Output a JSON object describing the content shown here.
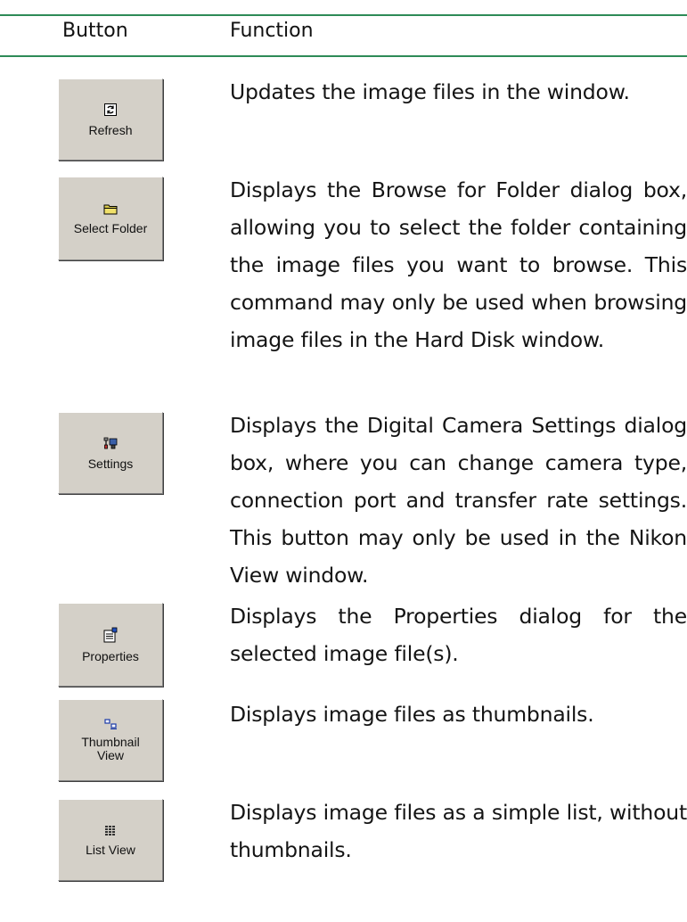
{
  "header": {
    "col_button": "Button",
    "col_function": "Function"
  },
  "rows": [
    {
      "button_label": "Refresh",
      "icon": "refresh-icon",
      "description": "Updates the image files in the window."
    },
    {
      "button_label": "Select Folder",
      "icon": "folder-icon",
      "description": "Displays the Browse for Folder dialog box, allowing you to select the folder containing the image files you want to browse. This command may only be used when browsing image files in the Hard Disk window."
    },
    {
      "button_label": "Settings",
      "icon": "settings-icon",
      "description": "Displays the Digital Camera Settings dialog box, where you can change camera type, connection port and transfer rate settings. This button may only be used in the Nikon View window."
    },
    {
      "button_label": "Properties",
      "icon": "properties-icon",
      "description": "Displays the Properties dialog for the selected image file(s)."
    },
    {
      "button_label_line1": "Thumbnail",
      "button_label_line2": "View",
      "icon": "thumbnail-view-icon",
      "description": "Displays image files as thumbnails."
    },
    {
      "button_label": "List View",
      "icon": "list-view-icon",
      "description": "Displays image files as a simple list, without thumbnails."
    }
  ],
  "colors": {
    "rule": "#2e8b57",
    "button_face": "#d4d0c8"
  }
}
